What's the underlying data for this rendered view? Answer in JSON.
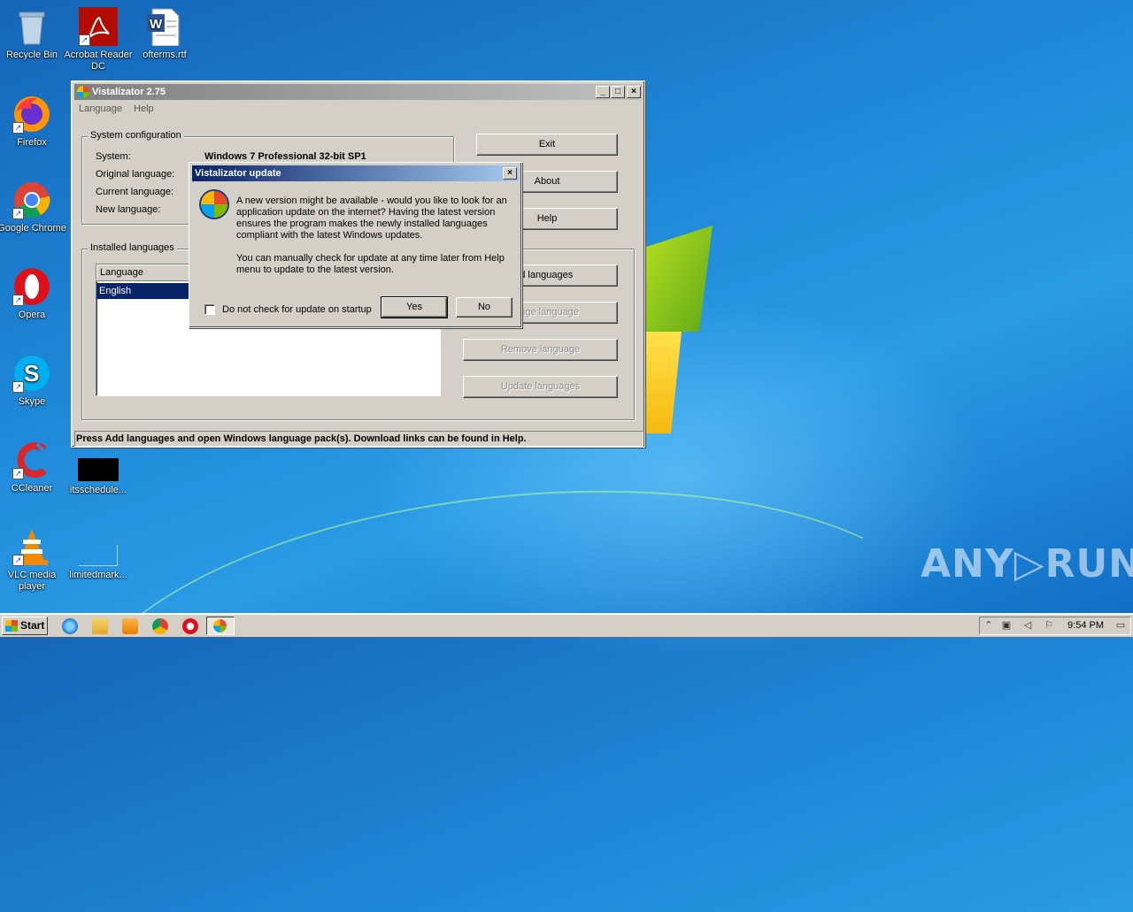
{
  "desktop": {
    "icons": [
      {
        "label": "Recycle Bin"
      },
      {
        "label": "Acrobat Reader DC"
      },
      {
        "label": "ofterms.rtf"
      },
      {
        "label": "Firefox"
      },
      {
        "label": "Google Chrome"
      },
      {
        "label": "Opera"
      },
      {
        "label": "Skype"
      },
      {
        "label": "CCleaner"
      },
      {
        "label": "itsschedule..."
      },
      {
        "label": "VLC media player"
      },
      {
        "label": "limitedmark..."
      }
    ],
    "watermark": "ANY▷RUN"
  },
  "main_window": {
    "title": "Vistalizator 2.75",
    "menu": [
      "Language",
      "Help"
    ],
    "system_config": {
      "group_label": "System configuration",
      "system_label": "System:",
      "system_value": "Windows 7 Professional 32-bit SP1",
      "original_language_label": "Original language:",
      "current_language_label": "Current language:",
      "new_language_label": "New language:"
    },
    "installed_languages": {
      "group_label": "Installed languages",
      "column_header": "Language",
      "rows": [
        "English"
      ]
    },
    "buttons": {
      "exit": "Exit",
      "about": "About",
      "help": "Help",
      "add_languages": "Add languages",
      "change_language": "Change language",
      "remove_language": "Remove language",
      "update_languages": "Update languages"
    },
    "status": "Press Add languages and open Windows language pack(s). Download links can be found in Help."
  },
  "dialog": {
    "title": "Vistalizator update",
    "close_glyph": "×",
    "paragraph1": "A new version might be available - would you like to look for an application update on the internet? Having the latest version ensures the program makes the newly installed languages compliant with the latest Windows updates.",
    "paragraph2": "You can manually check for update at any time later from Help menu to update to the latest version.",
    "checkbox_label": "Do not check for update on startup",
    "checkbox_checked": false,
    "yes": "Yes",
    "no": "No"
  },
  "taskbar": {
    "start": "Start",
    "clock": "9:54 PM"
  }
}
